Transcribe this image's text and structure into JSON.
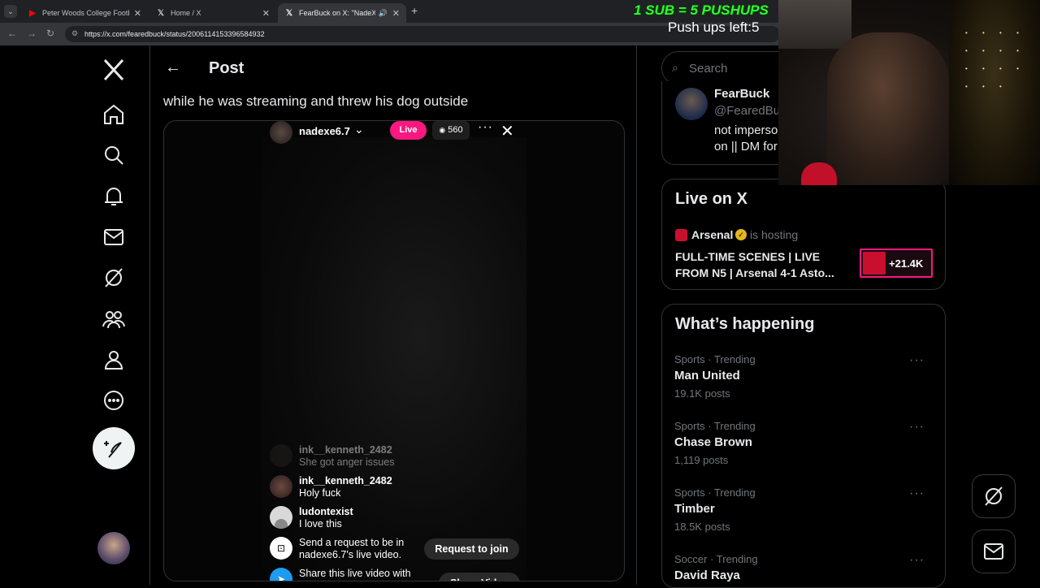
{
  "browser": {
    "tabs": [
      {
        "title": "Peter Woods College Football |",
        "icon": "youtube-icon"
      },
      {
        "title": "Home / X",
        "icon": "x-logo-icon"
      },
      {
        "title": "FearBuck on X: \"NadeXe cra",
        "icon": "x-logo-icon"
      }
    ],
    "url": "https://x.com/fearedbuck/status/2006114153396584932"
  },
  "overlay": {
    "title": "1 SUB = 5 PUSHUPS",
    "pushups": "Push ups left:5",
    "title_color": "#2bff2b"
  },
  "header": {
    "title": "Post"
  },
  "post": {
    "text": "while he was streaming and threw his dog outside"
  },
  "live_video": {
    "username": "nadexe6.7",
    "live_badge": "Live",
    "viewers": "560",
    "comments": [
      {
        "user": "ink__kenneth_2482",
        "text": "She got anger issues"
      },
      {
        "user": "ink__kenneth_2482",
        "text": "Holy fuck"
      },
      {
        "user": "ludontexist",
        "text": "I love this"
      }
    ],
    "request_text": "Send a request to be in nadexe6.7's live video.",
    "request_button": "Request to join",
    "share_text": "Share this live video with",
    "share_button": "Share Video"
  },
  "sidebar_right": {
    "search_placeholder": "Search",
    "profile": {
      "name": "FearBuck",
      "handle": "@FearedBu",
      "bio_line1": "not imperso",
      "bio_line2": "on || DM for"
    },
    "live_on_x": {
      "heading": "Live on X",
      "host": "Arsenal",
      "hosting_text": "is hosting",
      "title": "FULL-TIME SCENES | LIVE FROM N5 | Arsenal 4-1 Asto...",
      "count": "+21.4K"
    },
    "whats_happening": {
      "heading": "What’s happening",
      "trends": [
        {
          "meta": "Sports · Trending",
          "name": "Man United",
          "count": "19.1K posts"
        },
        {
          "meta": "Sports · Trending",
          "name": "Chase Brown",
          "count": "1,119 posts"
        },
        {
          "meta": "Sports · Trending",
          "name": "Timber",
          "count": "18.5K posts"
        },
        {
          "meta": "Soccer · Trending",
          "name": "David Raya",
          "count": ""
        }
      ]
    }
  },
  "colors": {
    "live_red": "#f91880",
    "arsenal_red": "#c8102e",
    "accent": "#1d9bf0"
  }
}
